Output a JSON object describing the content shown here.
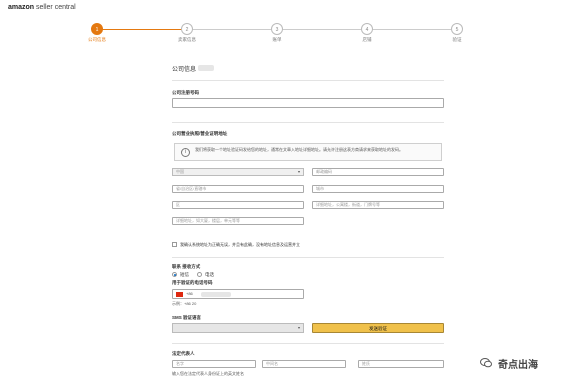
{
  "app": {
    "logo_main": "amazon",
    "logo_sub": "seller central"
  },
  "steps": [
    {
      "num": "1",
      "label": "公司信息"
    },
    {
      "num": "2",
      "label": "卖家信息"
    },
    {
      "num": "3",
      "label": "账单"
    },
    {
      "num": "4",
      "label": "店铺"
    },
    {
      "num": "5",
      "label": "验证"
    }
  ],
  "form": {
    "section_title": "公司信息",
    "reg_number_label": "公司注册号码",
    "address_label": "公司营业执照/营业证明地址",
    "info_text": "我们将获取一个地址验证码发给您的地址，通常在文章入地址详细地址。请允许注册这表方商请求来获取地址的发码。",
    "country_placeholder": "中国",
    "postal_placeholder": "邮政编码",
    "province_placeholder": "省/自治区/直辖市",
    "city_placeholder": "城市",
    "district_placeholder": "区",
    "address2_placeholder": "详细地址，公寓楼，街道，门牌号等",
    "address1_placeholder": "详细地址，如大厦，楼层，单元等等",
    "checkbox_text": "我确认系统地址为正确无误，并且有此确，没有地址信息及运营并立",
    "contact_method_label": "联系 接收方式",
    "radio_sms": "短信",
    "radio_call": "电话",
    "phone_label": "用于验证的电话号码",
    "phone_prefix": "+86",
    "phone_note": "示例：+86 20",
    "sms_lang_label": "SMS 验证语言",
    "send_button": "发送验证",
    "contact_label": "法定代表人",
    "first_name": "名字",
    "middle_name": "中间名",
    "last_name": "姓氏",
    "contact_note": "输入您在法定代表人身份证上的英文姓名"
  },
  "watermark": "奇点出海",
  "colors": {
    "accent": "#e47911",
    "button": "#f0c14b"
  }
}
